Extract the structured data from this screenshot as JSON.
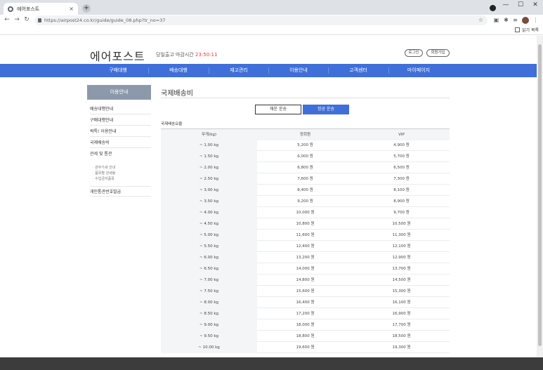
{
  "browser": {
    "tab_title": "에어포스트",
    "tab_close": "×",
    "new_tab": "+",
    "url": "https://airpost24.co.kr/guide/guide_08.php?tr_no=37",
    "reading_list": "읽기 목록",
    "controls": {
      "back": "←",
      "forward": "→",
      "reload": "↻",
      "minimize": "—",
      "maximize": "☐",
      "close": "✕",
      "star": "☆",
      "puzzle": "✱",
      "menu": "⋮"
    }
  },
  "header": {
    "logo": "에어포스트",
    "deadline_label": "당일출고 마감시간",
    "deadline_time": "23:50:11",
    "login": "로그인",
    "signup": "회원가입"
  },
  "nav": {
    "items": [
      "구매대행",
      "배송대행",
      "재고관리",
      "이용안내",
      "고객센터",
      "마이페이지"
    ]
  },
  "sidebar": {
    "title": "이용안내",
    "items": [
      "배송대행안내",
      "구매대행안내",
      "럭특! 이용안내",
      "국제배송비",
      "관세 및 통관"
    ],
    "subitems": [
      "· 관부가세 안내",
      "· 품목별 관세율",
      "· 수입금지품목"
    ],
    "last_item": "개인통관번호발급"
  },
  "content": {
    "title": "국제배송비",
    "tab_sea": "해운 운송",
    "tab_air": "항공 운송",
    "table_caption": "국제배송요율",
    "table": {
      "headers": [
        "무게(kg)",
        "정회원",
        "VIP"
      ],
      "rows": [
        [
          "~ 1.00 kg",
          "5,200 원",
          "4,900 원"
        ],
        [
          "~ 1.50 kg",
          "6,000 원",
          "5,700 원"
        ],
        [
          "~ 2.00 kg",
          "6,800 원",
          "6,500 원"
        ],
        [
          "~ 2.50 kg",
          "7,600 원",
          "7,300 원"
        ],
        [
          "~ 3.00 kg",
          "8,400 원",
          "8,100 원"
        ],
        [
          "~ 3.50 kg",
          "9,200 원",
          "8,900 원"
        ],
        [
          "~ 4.00 kg",
          "10,000 원",
          "9,700 원"
        ],
        [
          "~ 4.50 kg",
          "10,800 원",
          "10,500 원"
        ],
        [
          "~ 5.00 kg",
          "11,600 원",
          "11,300 원"
        ],
        [
          "~ 5.50 kg",
          "12,400 원",
          "12,100 원"
        ],
        [
          "~ 6.00 kg",
          "13,200 원",
          "12,900 원"
        ],
        [
          "~ 6.50 kg",
          "14,000 원",
          "13,700 원"
        ],
        [
          "~ 7.00 kg",
          "14,800 원",
          "14,500 원"
        ],
        [
          "~ 7.50 kg",
          "15,600 원",
          "15,300 원"
        ],
        [
          "~ 8.00 kg",
          "16,400 원",
          "16,100 원"
        ],
        [
          "~ 8.50 kg",
          "17,200 원",
          "16,900 원"
        ],
        [
          "~ 9.00 kg",
          "18,000 원",
          "17,700 원"
        ],
        [
          "~ 9.50 kg",
          "18,800 원",
          "18,500 원"
        ],
        [
          "~ 10.00 kg",
          "19,600 원",
          "19,300 원"
        ]
      ]
    }
  }
}
